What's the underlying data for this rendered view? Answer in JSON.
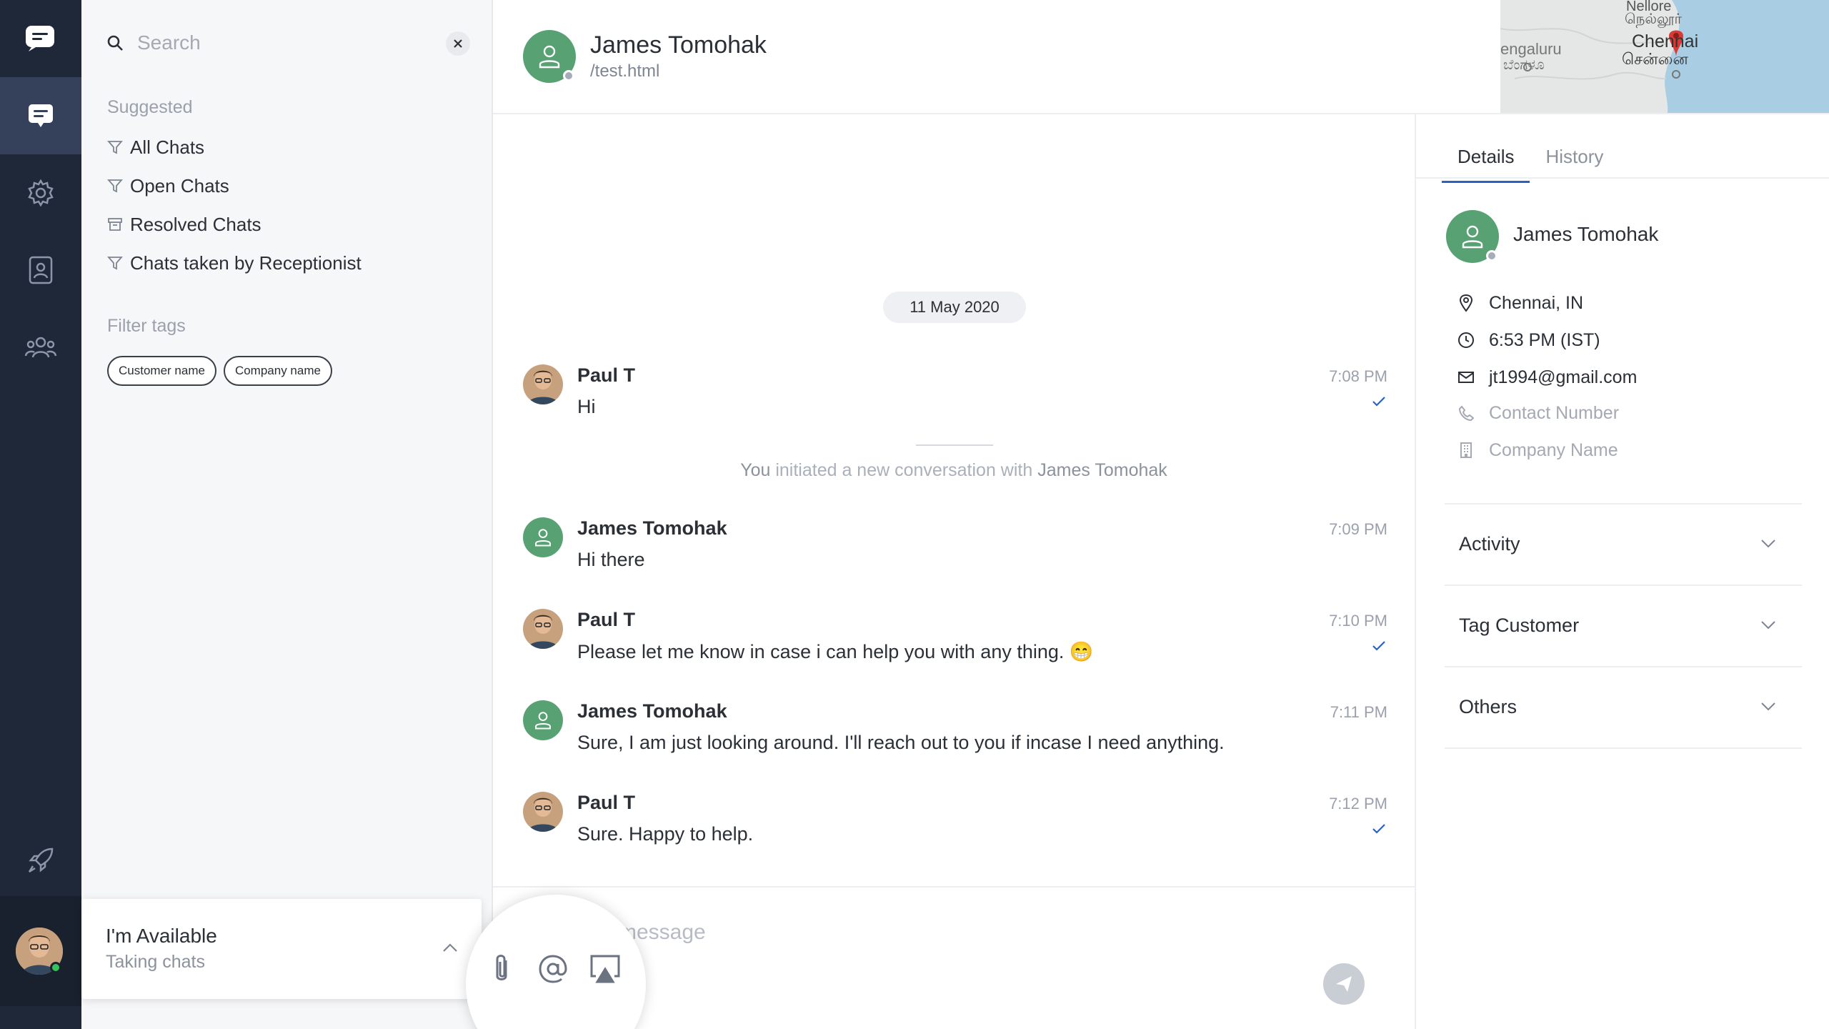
{
  "sidebar": {
    "items": [
      {
        "icon": "logo-icon"
      },
      {
        "icon": "chat-icon",
        "active": true
      },
      {
        "icon": "gear-icon"
      },
      {
        "icon": "contacts-icon"
      },
      {
        "icon": "team-icon"
      },
      {
        "icon": "rocket-icon"
      }
    ]
  },
  "filters": {
    "search_placeholder": "Search",
    "suggested_label": "Suggested",
    "items": [
      "All Chats",
      "Open Chats",
      "Resolved Chats",
      "Chats taken by Receptionist"
    ],
    "filter_tags_label": "Filter tags",
    "tags": [
      "Customer name",
      "Company name"
    ]
  },
  "availability": {
    "title": "I'm Available",
    "subtitle": "Taking chats"
  },
  "header": {
    "name": "James Tomohak",
    "url": "/test.html",
    "map_labels": [
      "Nellore",
      "நெல்லூர்",
      "engaluru",
      "ಬೆಂಗಳೂ",
      "Chennai",
      "சென்னை"
    ]
  },
  "conversation": {
    "date": "11 May 2020",
    "messages": [
      {
        "sender": "Paul T",
        "text": "Hi",
        "time": "7:08 PM",
        "read": true
      },
      {
        "sender": "James Tomohak",
        "text": "Hi there",
        "time": "7:09 PM",
        "read": false
      },
      {
        "sender": "Paul T",
        "text": "Please let me know in case i can help you with any thing. 😁",
        "time": "7:10 PM",
        "read": true
      },
      {
        "sender": "James Tomohak",
        "text": "Sure, I am just looking around. I'll reach out to you if incase I need anything.",
        "time": "7:11 PM",
        "read": false
      },
      {
        "sender": "Paul T",
        "text": "Sure. Happy to help.",
        "time": "7:12 PM",
        "read": true
      }
    ],
    "system_note": {
      "you": "You",
      "middle": "initiated a new conversation with",
      "name": "James Tomohak"
    }
  },
  "composer": {
    "placeholder": "message",
    "actions": [
      "attachment-icon",
      "mention-icon",
      "screen-share-icon"
    ]
  },
  "details": {
    "tabs": [
      "Details",
      "History"
    ],
    "active_tab": "Details",
    "name": "James Tomohak",
    "location": "Chennai, IN",
    "local_time": "6:53 PM (IST)",
    "email": "jt1994@gmail.com",
    "phone_placeholder": "Contact Number",
    "company_placeholder": "Company Name",
    "sections": [
      "Activity",
      "Tag Customer",
      "Others"
    ]
  },
  "colors": {
    "rail": "#1f2838",
    "rail_active": "#35405a",
    "avatar_green": "#57a173",
    "accent_blue": "#2b61c7",
    "online": "#36c45a",
    "map_pin": "#d93a35"
  }
}
